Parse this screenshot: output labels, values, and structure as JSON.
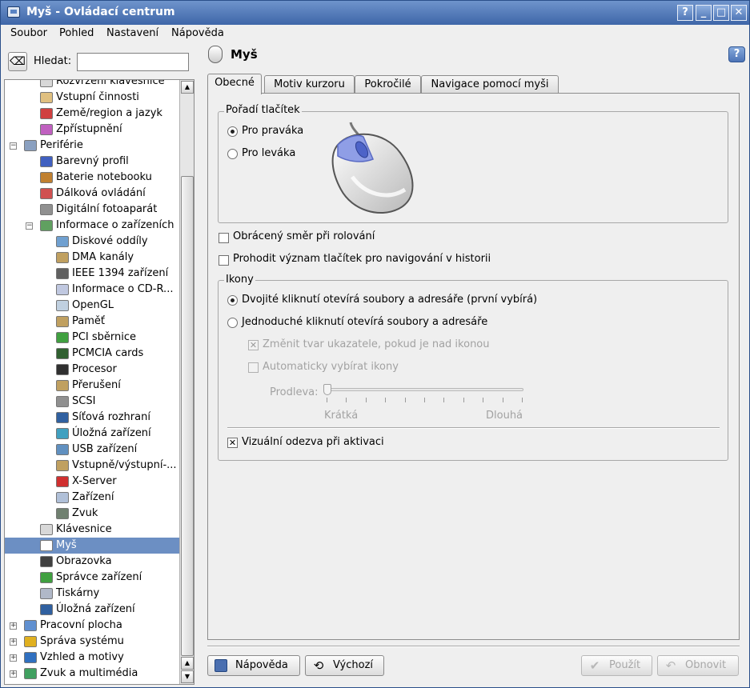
{
  "window": {
    "title": "Myš - Ovládací centrum",
    "buttons": [
      "?",
      "_",
      "□",
      "✕"
    ]
  },
  "menu": [
    "Soubor",
    "Pohled",
    "Nastavení",
    "Nápověda"
  ],
  "search": {
    "label": "Hledat:",
    "value": ""
  },
  "tree": {
    "items": [
      {
        "label": "Rozvržení klávesnice",
        "level": 2,
        "icon": "keyboard-icon",
        "color": "#d8d8d8"
      },
      {
        "label": "Vstupní činnosti",
        "level": 2,
        "icon": "input-actions-icon",
        "color": "#e0c080"
      },
      {
        "label": "Země/region a jazyk",
        "level": 2,
        "icon": "flag-icon",
        "color": "#d04040"
      },
      {
        "label": "Zpřístupnění",
        "level": 2,
        "icon": "accessibility-icon",
        "color": "#c060c0"
      },
      {
        "label": "Periférie",
        "level": 1,
        "icon": "peripherals-icon",
        "color": "#8aa0c0",
        "expanded": true
      },
      {
        "label": "Barevný profil",
        "level": 2,
        "icon": "color-profile-icon",
        "color": "#4060c0"
      },
      {
        "label": "Baterie notebooku",
        "level": 2,
        "icon": "battery-icon",
        "color": "#c08030"
      },
      {
        "label": "Dálková ovládání",
        "level": 2,
        "icon": "remote-icon",
        "color": "#d05050"
      },
      {
        "label": "Digitální fotoaparát",
        "level": 2,
        "icon": "camera-icon",
        "color": "#909090"
      },
      {
        "label": "Informace o zařízeních",
        "level": 2,
        "icon": "device-info-icon",
        "color": "#60a060",
        "expanded": true
      },
      {
        "label": "Diskové oddíly",
        "level": 3,
        "icon": "partition-icon",
        "color": "#70a0d0"
      },
      {
        "label": "DMA kanály",
        "level": 3,
        "icon": "dma-icon",
        "color": "#c0a060"
      },
      {
        "label": "IEEE 1394 zařízení",
        "level": 3,
        "icon": "firewire-icon",
        "color": "#606060"
      },
      {
        "label": "Informace o CD-R...",
        "level": 3,
        "icon": "cdrom-icon",
        "color": "#c0c8e0"
      },
      {
        "label": "OpenGL",
        "level": 3,
        "icon": "opengl-icon",
        "color": "#c0d0e0"
      },
      {
        "label": "Paměť",
        "level": 3,
        "icon": "memory-icon",
        "color": "#c0a060"
      },
      {
        "label": "PCI sběrnice",
        "level": 3,
        "icon": "pci-icon",
        "color": "#40a040"
      },
      {
        "label": "PCMCIA cards",
        "level": 3,
        "icon": "pcmcia-icon",
        "color": "#306030"
      },
      {
        "label": "Procesor",
        "level": 3,
        "icon": "cpu-icon",
        "color": "#303030"
      },
      {
        "label": "Přerušení",
        "level": 3,
        "icon": "interrupt-icon",
        "color": "#c0a060"
      },
      {
        "label": "SCSI",
        "level": 3,
        "icon": "scsi-icon",
        "color": "#909090"
      },
      {
        "label": "Síťová rozhraní",
        "level": 3,
        "icon": "network-icon",
        "color": "#3060a0"
      },
      {
        "label": "Úložná zařízení",
        "level": 3,
        "icon": "storage-icon",
        "color": "#40a0c0"
      },
      {
        "label": "USB zařízení",
        "level": 3,
        "icon": "usb-icon",
        "color": "#6090c0"
      },
      {
        "label": "Vstupně/výstupní-...",
        "level": 3,
        "icon": "io-ports-icon",
        "color": "#c0a060"
      },
      {
        "label": "X-Server",
        "level": 3,
        "icon": "x-server-icon",
        "color": "#d03030"
      },
      {
        "label": "Zařízení",
        "level": 3,
        "icon": "devices-icon",
        "color": "#b0c0d8"
      },
      {
        "label": "Zvuk",
        "level": 3,
        "icon": "sound-icon",
        "color": "#708070"
      },
      {
        "label": "Klávesnice",
        "level": 2,
        "icon": "keyboard-icon",
        "color": "#d8d8d8"
      },
      {
        "label": "Myš",
        "level": 2,
        "icon": "mouse-icon",
        "color": "#ffffff",
        "selected": true
      },
      {
        "label": "Obrazovka",
        "level": 2,
        "icon": "display-icon",
        "color": "#404040"
      },
      {
        "label": "Správce zařízení",
        "level": 2,
        "icon": "device-manager-icon",
        "color": "#40a040"
      },
      {
        "label": "Tiskárny",
        "level": 2,
        "icon": "printer-icon",
        "color": "#b0b8c8"
      },
      {
        "label": "Úložná zařízení",
        "level": 2,
        "icon": "storage-icon",
        "color": "#3060a0"
      },
      {
        "label": "Pracovní plocha",
        "level": 1,
        "icon": "desktop-icon",
        "color": "#6090d0",
        "expanded": false
      },
      {
        "label": "Správa systému",
        "level": 1,
        "icon": "system-admin-icon",
        "color": "#e0b020",
        "expanded": false
      },
      {
        "label": "Vzhled a motivy",
        "level": 1,
        "icon": "appearance-icon",
        "color": "#3070c0",
        "expanded": false
      },
      {
        "label": "Zvuk a multimédia",
        "level": 1,
        "icon": "multimedia-icon",
        "color": "#40a060",
        "expanded": false
      }
    ]
  },
  "module": {
    "title": "Myš"
  },
  "tabs": [
    "Obecné",
    "Motiv kurzoru",
    "Pokročilé",
    "Navigace pomocí myši"
  ],
  "button_order": {
    "title": "Pořadí tlačítek",
    "right": "Pro praváka",
    "left": "Pro leváka",
    "selected": "right"
  },
  "reverse_scroll": "Obrácený směr při rolování",
  "swap_history": "Prohodit význam tlačítek pro navigování v historii",
  "icons": {
    "title": "Ikony",
    "double_click": "Dvojité kliknutí otevírá soubory a adresáře (první vybírá)",
    "single_click": "Jednoduché kliknutí otevírá soubory a adresáře",
    "change_pointer": "Změnit tvar ukazatele, pokud je nad ikonou",
    "auto_select": "Automaticky vybírat ikony",
    "delay_label": "Prodleva:",
    "short": "Krátká",
    "long": "Dlouhá",
    "visual_feedback": "Vizuální odezva při aktivaci",
    "delay_value": 0
  },
  "buttons": {
    "help": "Nápověda",
    "defaults": "Výchozí",
    "apply": "Použít",
    "reset": "Obnovit"
  }
}
